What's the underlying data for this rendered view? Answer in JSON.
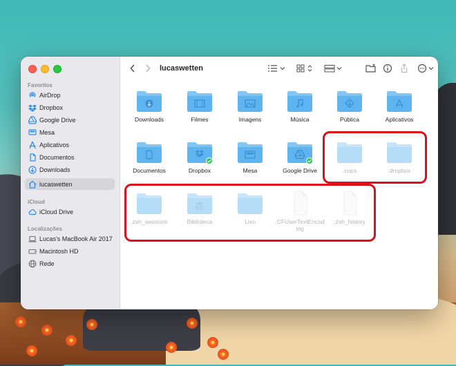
{
  "window": {
    "title": "lucaswetten"
  },
  "sidebar": {
    "sections": [
      {
        "label": "Favoritos"
      },
      {
        "label": "iCloud"
      },
      {
        "label": "Localizações"
      }
    ],
    "favorites": [
      {
        "label": "AirDrop",
        "icon": "airdrop-icon"
      },
      {
        "label": "Dropbox",
        "icon": "dropbox-icon"
      },
      {
        "label": "Google Drive",
        "icon": "google-drive-icon"
      },
      {
        "label": "Mesa",
        "icon": "desktop-icon"
      },
      {
        "label": "Aplicativos",
        "icon": "applications-icon"
      },
      {
        "label": "Documentos",
        "icon": "document-icon"
      },
      {
        "label": "Downloads",
        "icon": "download-icon"
      },
      {
        "label": "lucaswetten",
        "icon": "home-icon",
        "selected": true
      }
    ],
    "icloud": [
      {
        "label": "iCloud Drive",
        "icon": "cloud-icon"
      }
    ],
    "locations": [
      {
        "label": "Lucas's MacBook Air 2017",
        "icon": "laptop-icon"
      },
      {
        "label": "Macintosh HD",
        "icon": "disk-icon"
      },
      {
        "label": "Rede",
        "icon": "network-icon"
      }
    ]
  },
  "files": [
    {
      "name": "Downloads",
      "kind": "folder",
      "glyph": "download",
      "hidden": false
    },
    {
      "name": "Filmes",
      "kind": "folder",
      "glyph": "film",
      "hidden": false
    },
    {
      "name": "Imagens",
      "kind": "folder",
      "glyph": "image",
      "hidden": false
    },
    {
      "name": "Música",
      "kind": "folder",
      "glyph": "music",
      "hidden": false
    },
    {
      "name": "Pública",
      "kind": "folder",
      "glyph": "public",
      "hidden": false
    },
    {
      "name": "Aplicativos",
      "kind": "folder",
      "glyph": "apps",
      "hidden": false
    },
    {
      "name": "Documentos",
      "kind": "folder",
      "glyph": "doc",
      "hidden": false
    },
    {
      "name": "Dropbox",
      "kind": "folder",
      "glyph": "dropbox",
      "hidden": false,
      "synced": true
    },
    {
      "name": "Mesa",
      "kind": "folder",
      "glyph": "desktop",
      "hidden": false
    },
    {
      "name": "Google Drive",
      "kind": "folder",
      "glyph": "gdrive",
      "hidden": false,
      "synced": true
    },
    {
      "name": ".cups",
      "kind": "folder",
      "glyph": "",
      "hidden": true
    },
    {
      "name": ".dropbox",
      "kind": "folder",
      "glyph": "",
      "hidden": true
    },
    {
      "name": ".zsh_sessions",
      "kind": "folder",
      "glyph": "",
      "hidden": true
    },
    {
      "name": "Biblioteca",
      "kind": "folder",
      "glyph": "library",
      "hidden": true
    },
    {
      "name": "Lixo",
      "kind": "folder",
      "glyph": "",
      "hidden": true
    },
    {
      "name": ".CFUserTextEncoding",
      "kind": "file",
      "glyph": "",
      "hidden": true
    },
    {
      "name": ".zsh_history",
      "kind": "file",
      "glyph": "",
      "hidden": true
    }
  ],
  "colors": {
    "folder": "#5db4ef",
    "folder_tab": "#82c6f5",
    "highlight": "#e00d1b",
    "synced": "#34c759"
  }
}
